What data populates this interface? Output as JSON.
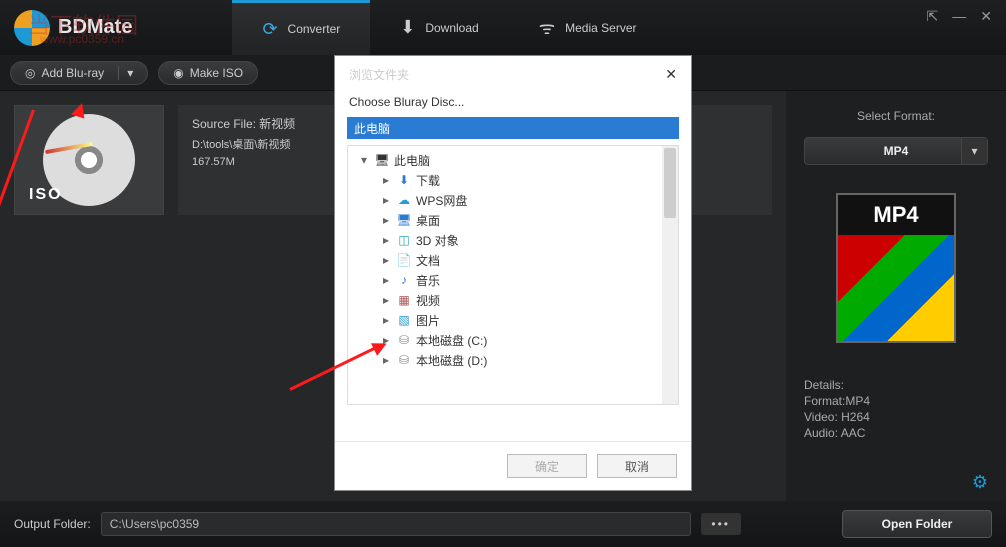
{
  "app": {
    "title": "BDMate"
  },
  "watermark": {
    "line1": "当下软件园",
    "line2": "www.pc0359.cn"
  },
  "tabs": [
    {
      "label": "Converter",
      "active": true
    },
    {
      "label": "Download",
      "active": false
    },
    {
      "label": "Media Server",
      "active": false
    }
  ],
  "toolbar": {
    "add": "Add Blu-ray",
    "makeiso": "Make ISO"
  },
  "source": {
    "label": "Source File:",
    "name": "新视频",
    "path": "D:\\tools\\桌面\\新视频",
    "size": "167.57M",
    "iso": "ISO"
  },
  "sidebar": {
    "select_format": "Select Format:",
    "format": "MP4",
    "preview_label": "MP4",
    "details_title": "Details:",
    "format_line": "Format:MP4",
    "video_line": "Video: H264",
    "audio_line": "Audio: AAC"
  },
  "dialog": {
    "title": "浏览文件夹",
    "subtitle": "Choose Bluray Disc...",
    "input": "此电脑",
    "tree": [
      {
        "level": 1,
        "exp": "▾",
        "icon": "🖥",
        "label": "此电脑"
      },
      {
        "level": 2,
        "exp": "▸",
        "icon": "⬇",
        "label": "下载",
        "color": "#2a7bd3"
      },
      {
        "level": 2,
        "exp": "▸",
        "icon": "☁",
        "label": "WPS网盘",
        "color": "#2a9bd6"
      },
      {
        "level": 2,
        "exp": "▸",
        "icon": "🖥",
        "label": "桌面",
        "color": "#2a7bd3"
      },
      {
        "level": 2,
        "exp": "▸",
        "icon": "◫",
        "label": "3D 对象",
        "color": "#2aa1a6"
      },
      {
        "level": 2,
        "exp": "▸",
        "icon": "📄",
        "label": "文档",
        "color": "#6a8"
      },
      {
        "level": 2,
        "exp": "▸",
        "icon": "♪",
        "label": "音乐",
        "color": "#2a7bd3"
      },
      {
        "level": 2,
        "exp": "▸",
        "icon": "▦",
        "label": "视频",
        "color": "#a55"
      },
      {
        "level": 2,
        "exp": "▸",
        "icon": "▧",
        "label": "图片",
        "color": "#2a9bd6"
      },
      {
        "level": 2,
        "exp": "▸",
        "icon": "⛁",
        "label": "本地磁盘 (C:)",
        "color": "#888"
      },
      {
        "level": 2,
        "exp": "▸",
        "icon": "⛁",
        "label": "本地磁盘 (D:)",
        "color": "#888"
      }
    ],
    "ok": "确定",
    "cancel": "取消"
  },
  "footer": {
    "label": "Output Folder:",
    "path": "C:\\Users\\pc0359",
    "browse": "•••",
    "open": "Open Folder"
  }
}
